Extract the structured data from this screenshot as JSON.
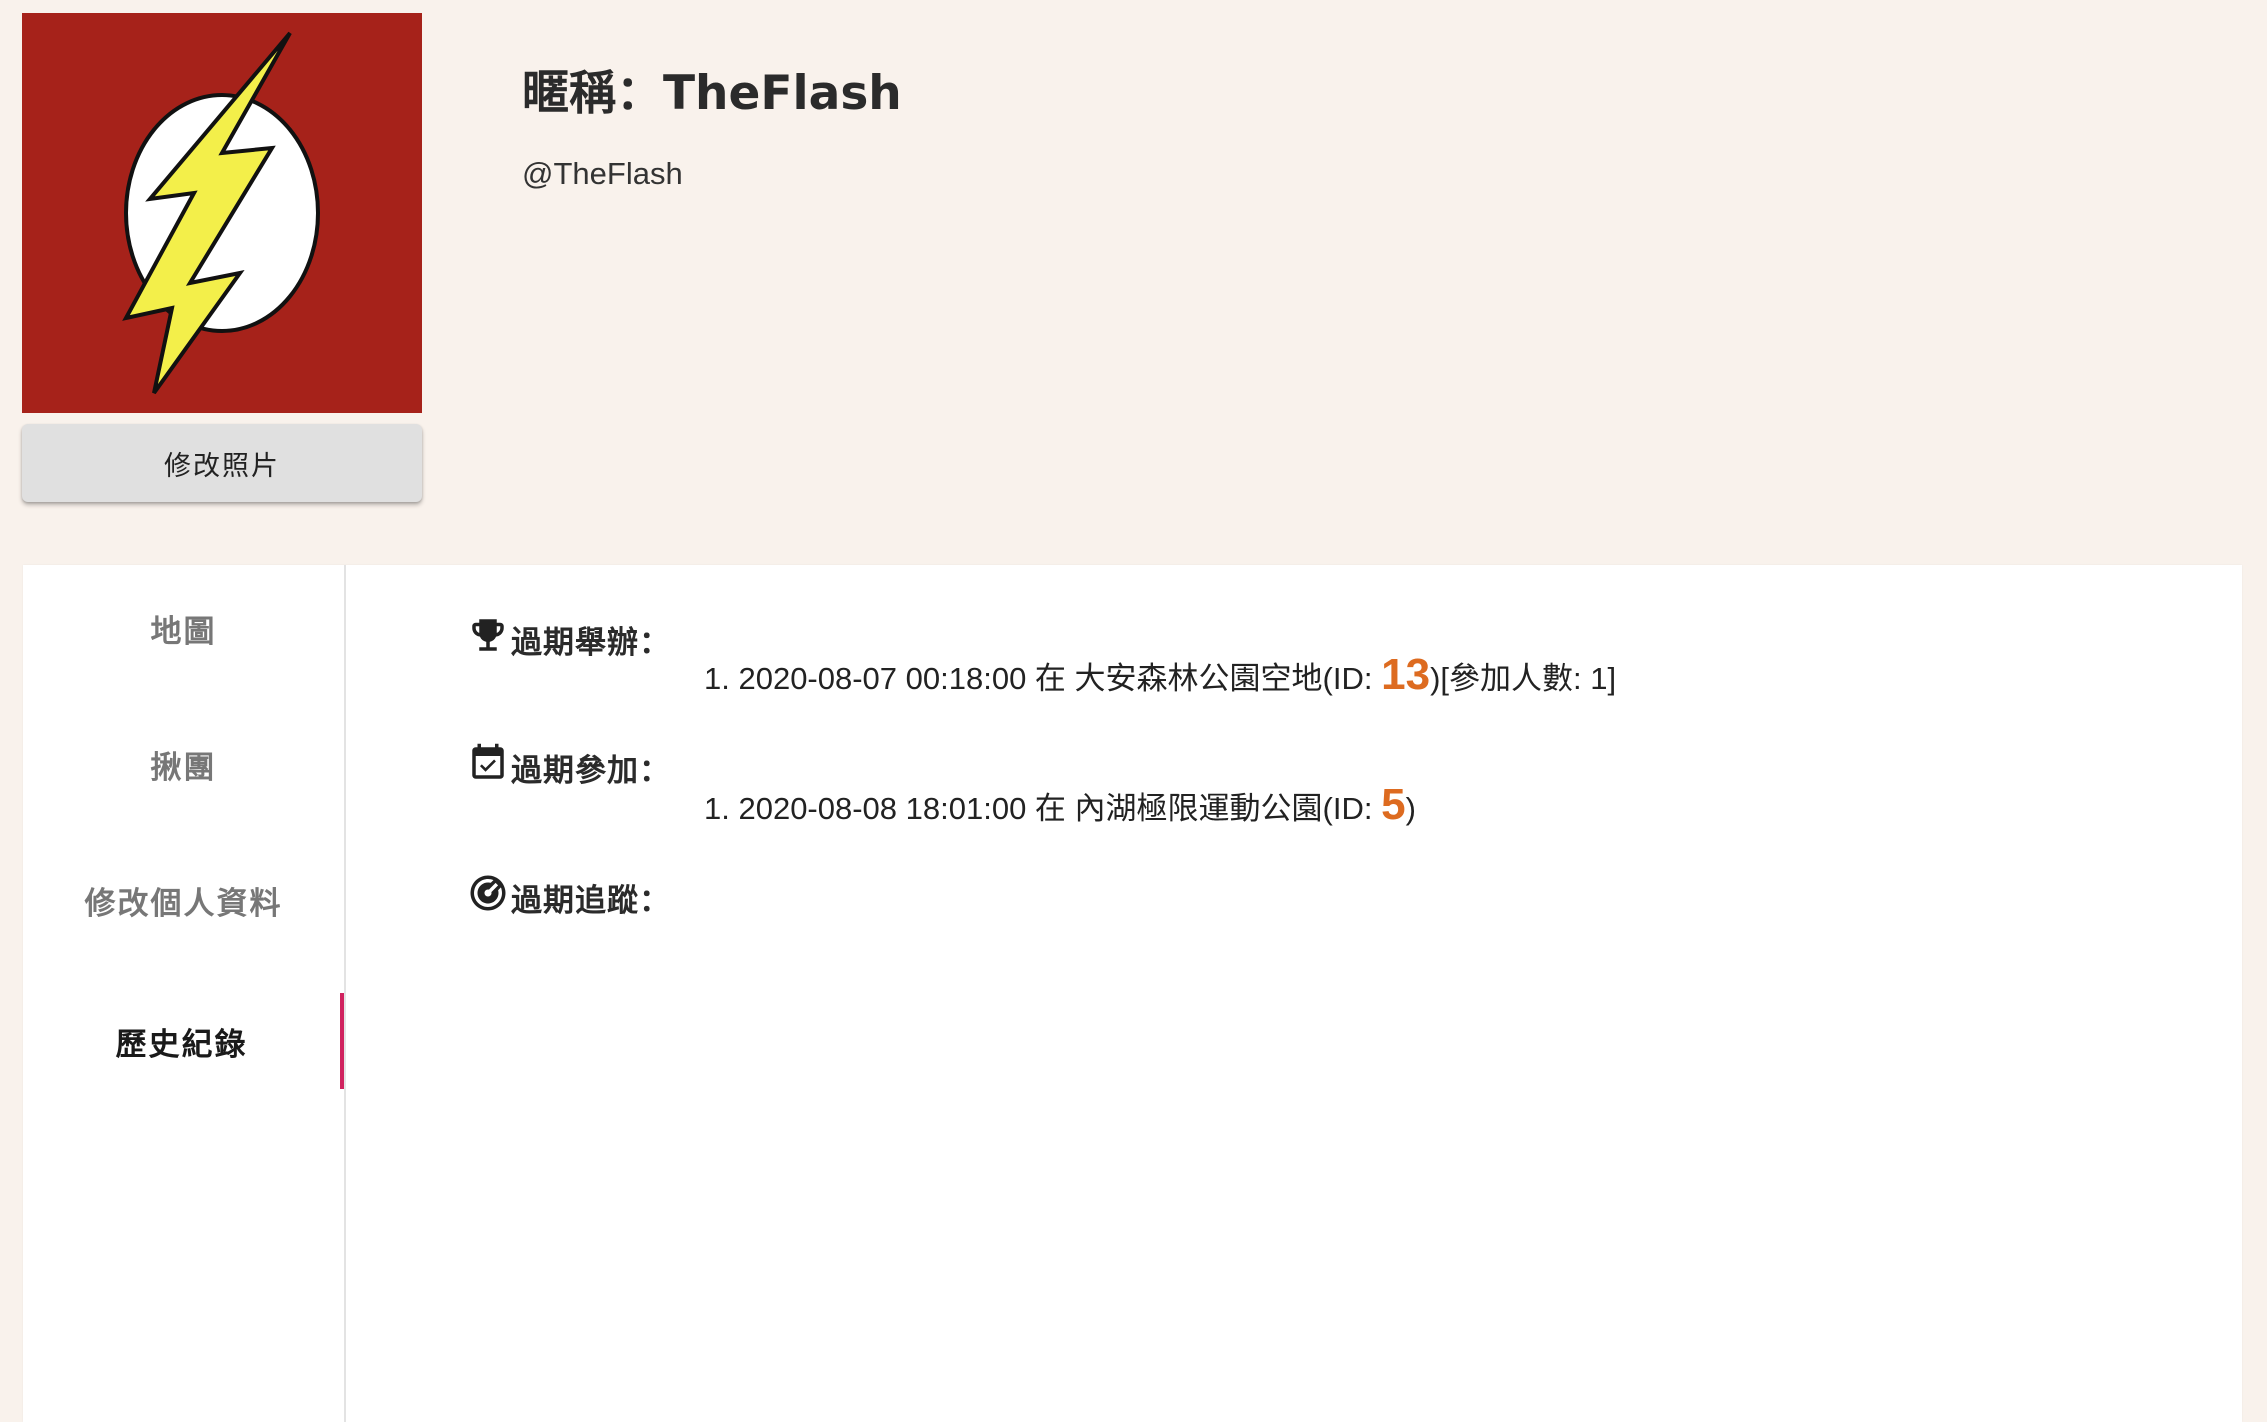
{
  "profile": {
    "avatar_icon": "flash-logo-icon",
    "change_photo_label": "修改照片",
    "nickname": "暱稱：TheFlash",
    "handle": "@TheFlash"
  },
  "sidebar": {
    "items": [
      {
        "label": "地圖",
        "active": false
      },
      {
        "label": "揪團",
        "active": false
      },
      {
        "label": "修改個人資料",
        "active": false
      },
      {
        "label": "歷史紀錄",
        "active": true
      }
    ],
    "active_indicator_color": "#d0225e"
  },
  "history": {
    "hosted": {
      "icon": "trophy-icon",
      "title": "過期舉辦：",
      "entries": [
        {
          "prefix": "1. 2020-08-07 00:18:00 在 大安森林公園空地(ID: ",
          "id": "13",
          "suffix": ")[參加人數: 1]"
        }
      ]
    },
    "joined": {
      "icon": "calendar-check-icon",
      "title": "過期參加：",
      "entries": [
        {
          "prefix": "1. 2020-08-08 18:01:00 在 內湖極限運動公園(ID: ",
          "id": "5",
          "suffix": ")"
        }
      ]
    },
    "followed": {
      "icon": "radar-icon",
      "title": "過期追蹤：",
      "entries": []
    }
  },
  "colors": {
    "background": "#f9f2ec",
    "avatar_red": "#a6221a",
    "id_accent": "#dd6b20"
  }
}
